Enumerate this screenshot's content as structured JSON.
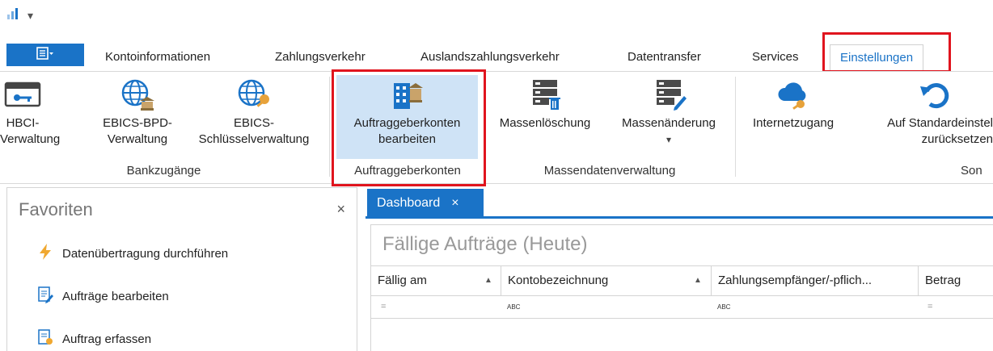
{
  "quick_access": {
    "icon": "bar-chart-icon",
    "dropdown": "▾"
  },
  "tabs": [
    {
      "label": "Kontoinformationen"
    },
    {
      "label": "Zahlungsverkehr"
    },
    {
      "label": "Auslandszahlungsverkehr"
    },
    {
      "label": "Datentransfer"
    },
    {
      "label": "Services"
    },
    {
      "label": "Einstellungen",
      "active": true
    }
  ],
  "ribbon": {
    "buttons": [
      {
        "label": "HBCI-\nVerwaltung",
        "icon": "card-key-icon"
      },
      {
        "label": "EBICS-BPD-\nVerwaltung",
        "icon": "globe-bank-icon"
      },
      {
        "label": "EBICS-\nSchlüsselverwaltung",
        "icon": "globe-key-icon"
      },
      {
        "label": "Auftraggeberkonten\nbearbeiten",
        "icon": "building-bank-icon",
        "selected": true
      },
      {
        "label": "Massenlöschung",
        "icon": "server-delete-icon"
      },
      {
        "label": "Massenänderung",
        "icon": "server-edit-icon",
        "dropdown": "▾"
      },
      {
        "label": "Internetzugang",
        "icon": "cloud-key-icon"
      },
      {
        "label": "Auf Standardeinstel\nzurücksetzen",
        "icon": "undo-icon"
      }
    ],
    "groups": [
      "Bankzugänge",
      "Auftraggeberkonten",
      "Massendatenverwaltung",
      "Son"
    ]
  },
  "favorites": {
    "title": "Favoriten",
    "close": "×",
    "items": [
      {
        "label": "Datenübertragung durchführen",
        "icon": "lightning-icon"
      },
      {
        "label": "Aufträge bearbeiten",
        "icon": "edit-document-icon"
      },
      {
        "label": "Auftrag erfassen",
        "icon": "new-document-icon"
      }
    ]
  },
  "dashboard": {
    "tab_label": "Dashboard",
    "tab_close": "×",
    "panel_title": "Fällige Aufträge (Heute)",
    "columns": [
      "Fällig am",
      "Kontobezeichnung",
      "Zahlungsempfänger/-pflich...",
      "Betrag"
    ],
    "filters": [
      "=",
      "ABC",
      "ABC",
      "="
    ]
  },
  "colors": {
    "accent": "#1a73c7",
    "highlight": "#e0141e",
    "selected_bg": "#cfe3f6"
  }
}
